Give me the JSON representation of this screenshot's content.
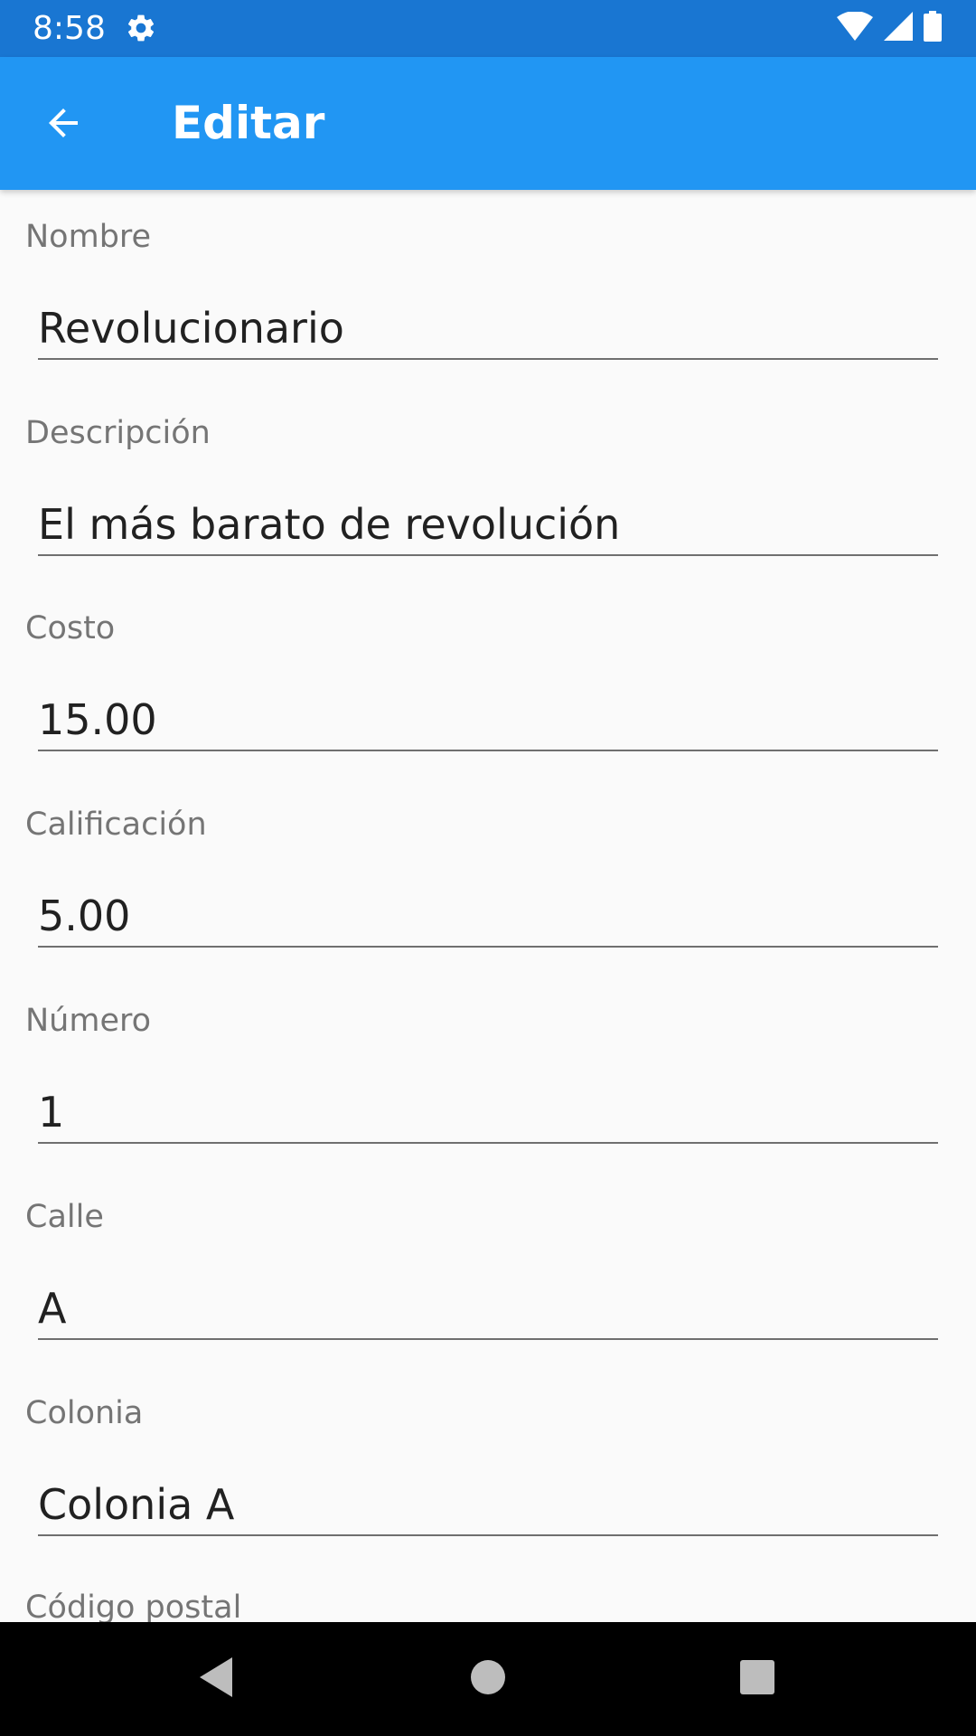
{
  "status_bar": {
    "time": "8:58",
    "icons": [
      "gear-icon",
      "wifi-icon",
      "signal-icon",
      "battery-icon"
    ]
  },
  "app_bar": {
    "title": "Editar",
    "back_icon": "arrow-back-icon",
    "background_color": "#2196f3",
    "status_color": "#1976d2"
  },
  "form": {
    "fields": [
      {
        "label": "Nombre",
        "value": "Revolucionario"
      },
      {
        "label": "Descripción",
        "value": "El más barato de revolución"
      },
      {
        "label": "Costo",
        "value": "15.00"
      },
      {
        "label": "Calificación",
        "value": "5.00"
      },
      {
        "label": "Número",
        "value": "1"
      },
      {
        "label": "Calle",
        "value": "A"
      },
      {
        "label": "Colonia",
        "value": "Colonia A"
      },
      {
        "label": "Código postal",
        "value": ""
      }
    ]
  },
  "nav_bar": {
    "icons": [
      "back-triangle-icon",
      "home-circle-icon",
      "recents-square-icon"
    ]
  }
}
